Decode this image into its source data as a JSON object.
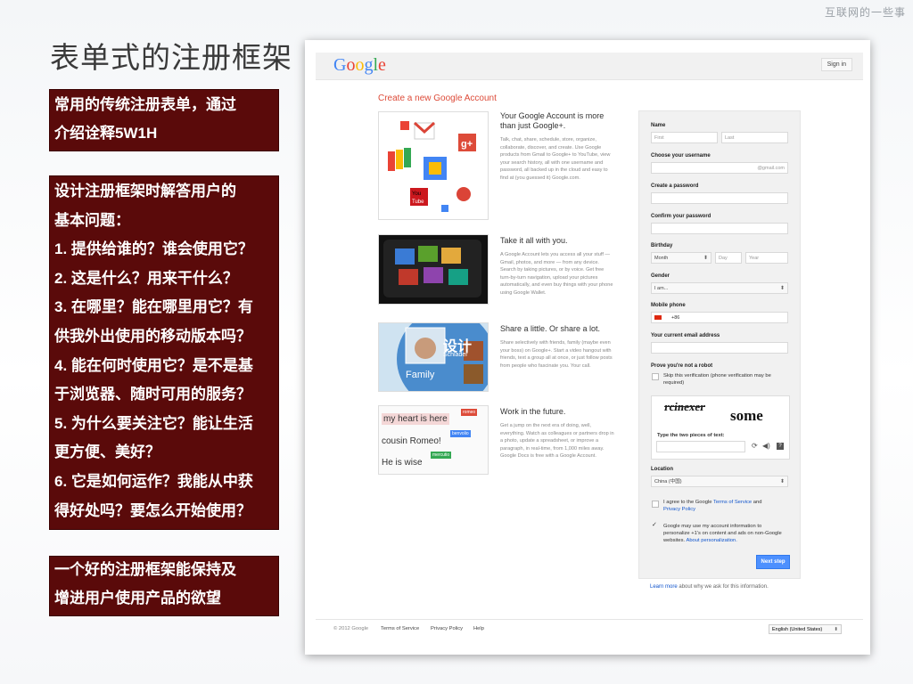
{
  "corner_text": "互联网的一些事",
  "slide_title": "表单式的注册框架",
  "box1": [
    "常用的传统注册表单，通过",
    "介绍诠释5W1H"
  ],
  "box2": [
    "设计注册框架时解答用户的",
    "基本问题：",
    "1. 提供给谁的？谁会使用它？",
    "2. 这是什么？用来干什么？",
    "3. 在哪里？能在哪里用它？有",
    "供我外出使用的移动版本吗？",
    "4. 能在何时使用它？是不是基",
    "于浏览器、随时可用的服务？",
    "5. 为什么要关注它？能让生活",
    "更方便、美好？",
    "6. 它是如何运作？我能从中获",
    "得好处吗？要怎么开始使用？"
  ],
  "box3": [
    "一个好的注册框架能保持及",
    "增进用户使用产品的欲望"
  ],
  "screenshot": {
    "logo_letters": [
      "G",
      "o",
      "o",
      "g",
      "l",
      "e"
    ],
    "logo_colors": [
      "#4285f4",
      "#ea4335",
      "#fbbc05",
      "#4285f4",
      "#34a853",
      "#ea4335"
    ],
    "sign_in": "Sign in",
    "create_heading": "Create a new Google Account",
    "features": [
      {
        "title": "Your Google Account is more than just Google+.",
        "text": "Talk, chat, share, schedule, store, organize, collaborate, discover, and create. Use Google products from Gmail to Google+ to YouTube, view your search history, all with one username and password, all backed up in the cloud and easy to find at (you guessed it) Google.com."
      },
      {
        "title": "Take it all with you.",
        "text": "A Google Account lets you access all your stuff — Gmail, photos, and more — from any device. Search by taking pictures, or by voice. Get free turn-by-turn navigation, upload your pictures automatically, and even buy things with your phone using Google Wallet."
      },
      {
        "title": "Share a little. Or share a lot.",
        "text": "Share selectively with friends, family (maybe even your boss) on Google+. Start a video hangout with friends, text a group all at once, or just follow posts from people who fascinate you. Your call."
      },
      {
        "title": "Work in the future.",
        "text": "Get a jump on the next era of doing, well, everything. Watch as colleagues or partners drop in a photo, update a spreadsheet, or improve a paragraph, in real-time, from 1,000 miles away. Google Docs is free with a Google Account."
      }
    ],
    "thumb3_text": {
      "overlay": "设计",
      "name": "Schlader",
      "family": "Family"
    },
    "thumb4_lines": [
      {
        "text": "my heart is here",
        "tag": "romeo"
      },
      {
        "text": "cousin Romeo!",
        "tag": "benvolio"
      },
      {
        "text": "He is wise",
        "tag": "mercutio"
      }
    ],
    "form": {
      "name_label": "Name",
      "first_ph": "First",
      "last_ph": "Last",
      "username_label": "Choose your username",
      "gmail_suffix": "@gmail.com",
      "password_label": "Create a password",
      "confirm_label": "Confirm your password",
      "birthday_label": "Birthday",
      "month": "Month",
      "day": "Day",
      "year": "Year",
      "gender_label": "Gender",
      "gender_value": "I am...",
      "mobile_label": "Mobile phone",
      "mobile_prefix": "+86",
      "email_label": "Your current email address",
      "robot_label": "Prove you're not a robot",
      "skip_text": "Skip this verification (phone verification may be required)",
      "captcha_word1": "rcinexer",
      "captcha_word2": "some",
      "captcha_prompt": "Type the two pieces of text:",
      "location_label": "Location",
      "location_value": "China (中国)",
      "agree_text_1": "I agree to the Google ",
      "agree_link_1": "Terms of Service",
      "agree_text_2": " and",
      "agree_link_2": "Privacy Policy",
      "personalize_text": "Google may use my account information to personalize +1's on content and ads on non-Google websites. ",
      "personalize_link": "About personalization.",
      "next_button": "Next step",
      "learn_more_link": "Learn more",
      "learn_more_rest": " about why we ask for this information."
    },
    "footer": {
      "copyright": "© 2012 Google",
      "links": [
        "Terms of Service",
        "Privacy Policy",
        "Help"
      ],
      "language": "English (United States)"
    }
  }
}
